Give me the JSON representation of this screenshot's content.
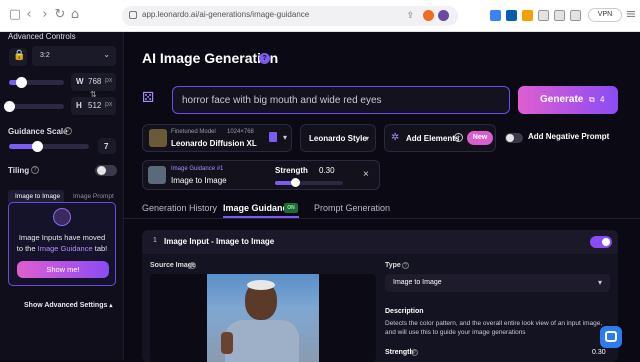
{
  "browser": {
    "url": "app.leonardo.ai/ai-generations/image-guidance",
    "vpn": "VPN"
  },
  "sidebar": {
    "advanced_controls": "Advanced Controls",
    "aspect_ratio": "3:2",
    "width_label": "W",
    "width_value": "768",
    "height_label": "H",
    "height_value": "512",
    "unit": "px",
    "guidance_scale_label": "Guidance Scale",
    "guidance_scale_value": "7",
    "tiling_label": "Tiling",
    "tab_image_to_image": "Image to Image",
    "tab_image_prompt": "Image Prompt",
    "notice_line1": "Image Inputs have moved",
    "notice_line2_pre": "to the ",
    "notice_line2_link": "Image Guidance",
    "notice_line2_post": " tab!",
    "show_me": "Show me!",
    "show_advanced": "Show Advanced Settings"
  },
  "main": {
    "title": "AI Image Generation",
    "prompt_value": "horror face with big mouth and wide red eyes",
    "generate_label": "Generate",
    "generate_cost": "4",
    "model_finetuned": "Finetuned Model",
    "model_size": "1024×768",
    "model_name": "Leonardo Diffusion XL",
    "style_label": "Leonardo Style",
    "add_elements": "Add Elements",
    "new_badge": "New",
    "add_negative": "Add Negative Prompt",
    "guidance_chip_small": "Image Guidance #1",
    "guidance_chip_main": "Image to Image",
    "strength_label": "Strength",
    "strength_value": "0.30",
    "strength_fraction": 0.3,
    "tabs": [
      "Generation History",
      "Image Guidance",
      "Prompt Generation"
    ],
    "tab_on_badge": "ON",
    "section_index": "1",
    "section_title": "Image Input - Image to Image",
    "source_image_label": "Source Image",
    "type_label": "Type",
    "type_value": "Image to Image",
    "description_label": "Description",
    "description_text": "Detects the color pattern, and the overall entire look view of an input image, and will use this to guide your image generations",
    "strength2_label": "Strength",
    "strength2_value": "0.30"
  },
  "colors": {
    "accent": "#7b5cf0",
    "gradient_start": "#e05ed0",
    "gradient_end": "#8a4cf4"
  }
}
